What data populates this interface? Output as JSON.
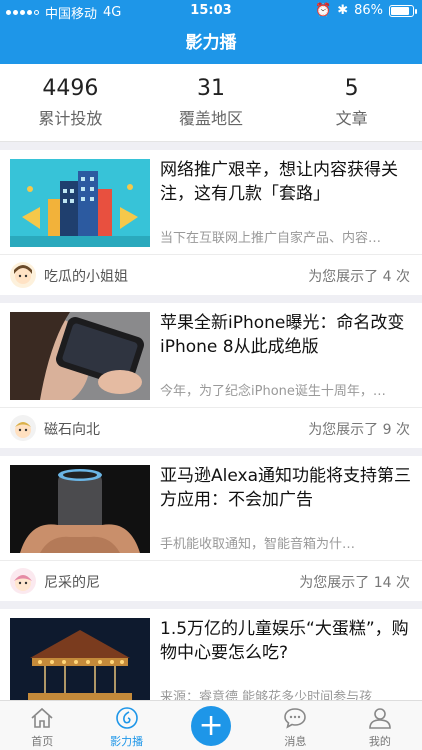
{
  "status_bar": {
    "carrier": "中国移动",
    "network": "4G",
    "time": "15:03",
    "battery": "86%",
    "battery_level": 0.86
  },
  "header": {
    "title": "影力播"
  },
  "stats": [
    {
      "value": "4496",
      "label": "累计投放"
    },
    {
      "value": "31",
      "label": "覆盖地区"
    },
    {
      "value": "5",
      "label": "文章"
    }
  ],
  "articles": [
    {
      "title": "网络推广艰辛，想让内容获得关注，这有几款「套路」",
      "summary": "当下在互联网上推广自家产品、内容…",
      "author": "吃瓜的小姐姐",
      "shown": "为您展示了 4 次"
    },
    {
      "title": "苹果全新iPhone曝光：命名改变 iPhone 8从此成绝版",
      "summary": "今年，为了纪念iPhone诞生十周年，…",
      "author": "磁石向北",
      "shown": "为您展示了 9 次"
    },
    {
      "title": "亚马逊Alexa通知功能将支持第三方应用：不会加广告",
      "summary": "手机能收取通知，智能音箱为什…",
      "author": "尼采的尼",
      "shown": "为您展示了 14 次"
    },
    {
      "title": "1.5万亿的儿童娱乐“大蛋糕”，购物中心要怎么吃?",
      "summary": "来源：睿意德 能够花多少时间参与孩",
      "author": "",
      "shown": ""
    }
  ],
  "tabbar": {
    "items": [
      {
        "label": "首页",
        "icon": "home-icon"
      },
      {
        "label": "影力播",
        "icon": "broadcast-icon"
      },
      {
        "label": "",
        "icon": "plus-icon"
      },
      {
        "label": "消息",
        "icon": "message-icon"
      },
      {
        "label": "我的",
        "icon": "profile-icon"
      }
    ]
  },
  "colors": {
    "accent": "#1e96e8",
    "background": "#efeff4"
  }
}
